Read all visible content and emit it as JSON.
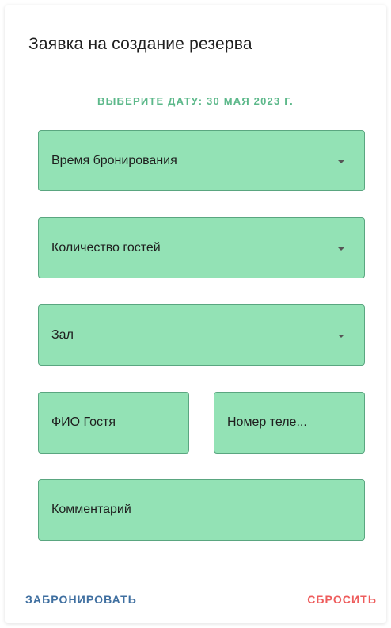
{
  "form": {
    "title": "Заявка на создание резерва",
    "date_button": "ВЫБЕРИТЕ ДАТУ: 30 МАЯ 2023 Г.",
    "fields": {
      "time": "Время бронирования",
      "guests": "Количество гостей",
      "hall": "Зал",
      "name": "ФИО Гостя",
      "phone": "Номер теле...",
      "comment": "Комментарий"
    },
    "actions": {
      "book": "ЗАБРОНИРОВАТЬ",
      "reset": "СБРОСИТЬ"
    }
  },
  "colors": {
    "field_background": "#93e2b5",
    "field_border": "#5aa680",
    "date_accent": "#5cb88a",
    "book_accent": "#3f6fa0",
    "reset_accent": "#ee5c5c"
  },
  "icons": {
    "dropdown": "chevron-down-icon"
  }
}
